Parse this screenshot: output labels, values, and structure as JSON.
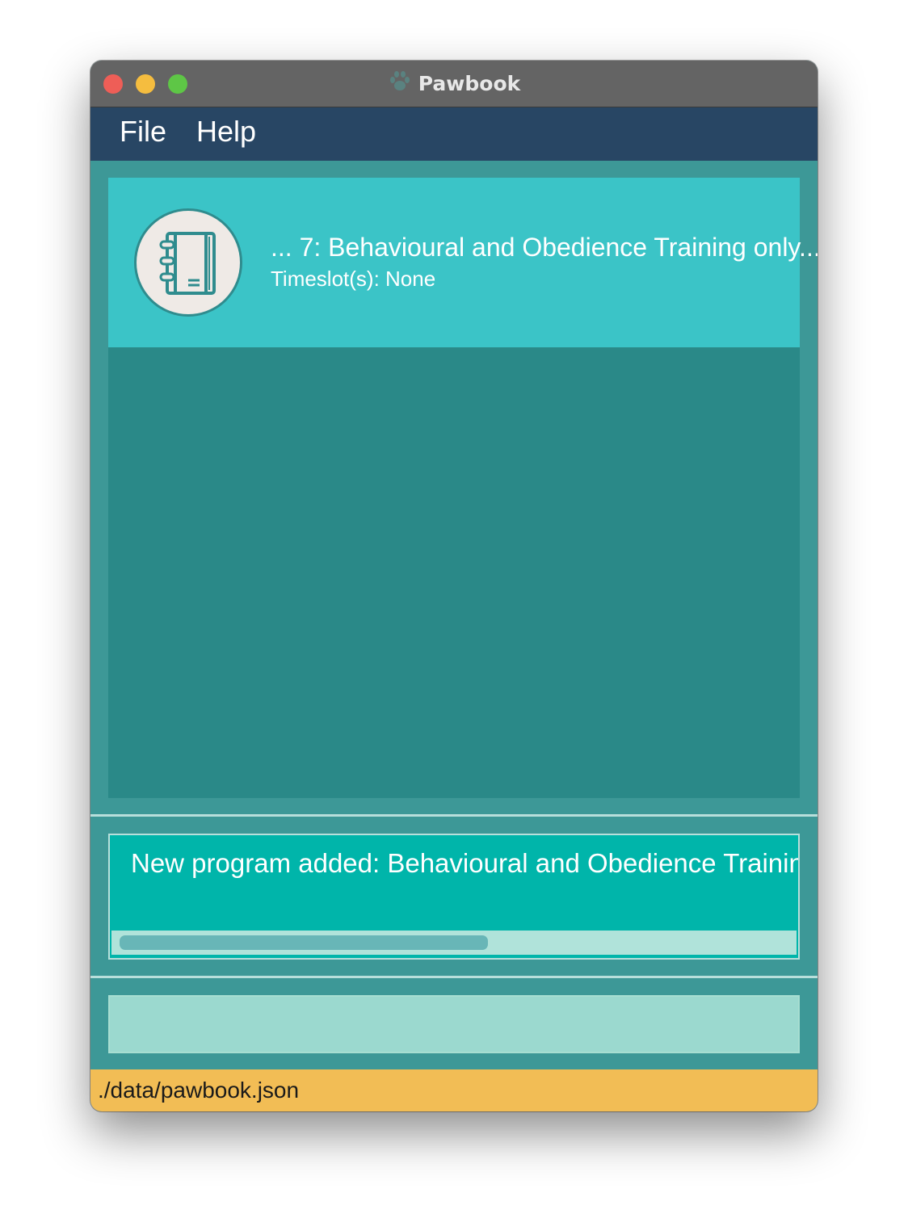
{
  "window": {
    "title": "Pawbook",
    "title_icon": "paw-icon"
  },
  "menu": {
    "items": [
      {
        "label": "File"
      },
      {
        "label": "Help"
      }
    ]
  },
  "list": {
    "items": [
      {
        "icon": "notebook-icon",
        "title": "... 7:  Behavioural and Obedience Training only...",
        "subtitle": "Timeslot(s): None"
      }
    ]
  },
  "result": {
    "text": "New program added: Behavioural and Obedience Training"
  },
  "command": {
    "value": "",
    "placeholder": ""
  },
  "status": {
    "path": "./data/pawbook.json"
  },
  "colors": {
    "titlebar": "#646464",
    "menubar": "#284664",
    "panel": "#3d9897",
    "list_bg": "#2a8988",
    "card": "#3bc4c7",
    "result_bg": "#00b5aa",
    "command_bg": "#9bd9cf",
    "statusbar": "#f2bd55"
  }
}
